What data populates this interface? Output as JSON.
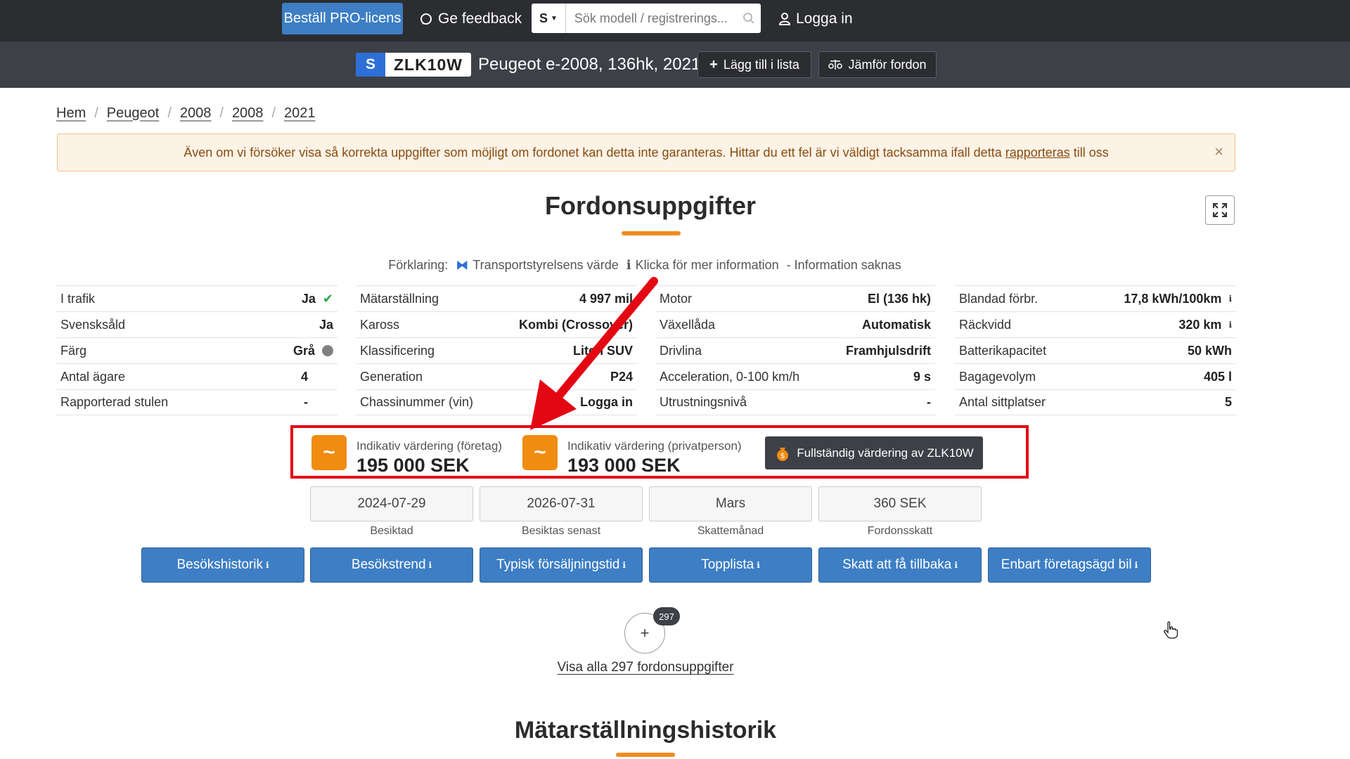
{
  "topbar": {
    "pro_label": "Beställ PRO-licens",
    "feedback_label": "Ge feedback",
    "search_select": "S",
    "search_placeholder": "Sök modell / registrerings...",
    "login_label": "Logga in"
  },
  "vehicle": {
    "plate_country": "S",
    "plate": "ZLK10W",
    "title": "Peugeot e-2008, 136hk, 2021",
    "add_list_label": "Lägg till i lista",
    "compare_label": "Jämför fordon"
  },
  "breadcrumb": [
    "Hem",
    "Peugeot",
    "2008",
    "2008",
    "2021"
  ],
  "alert": {
    "text_before": "Även om vi försöker visa så korrekta uppgifter som möjligt om fordonet kan detta inte garanteras. Hittar du ett fel är vi väldigt tacksamma ifall detta",
    "link": "rapporteras",
    "text_after": "till oss"
  },
  "section_title": "Fordonsuppgifter",
  "legend": {
    "prefix": "Förklaring:",
    "item1": "Transportstyrelsens värde",
    "item2": "Klicka för mer information",
    "item3": "- Information saknas"
  },
  "columns": [
    [
      {
        "label": "I trafik",
        "value": "Ja"
      },
      {
        "label": "Svensksåld",
        "value": "Ja"
      },
      {
        "label": "Färg",
        "value": "Grå"
      },
      {
        "label": "Antal ägare",
        "value": "4"
      },
      {
        "label": "Rapporterad stulen",
        "value": "-"
      }
    ],
    [
      {
        "label": "Mätarställning",
        "value": "4 997 mil"
      },
      {
        "label": "Kaross",
        "value": "Kombi (Crossover)"
      },
      {
        "label": "Klassificering",
        "value": "Liten SUV"
      },
      {
        "label": "Generation",
        "value": "P24"
      },
      {
        "label": "Chassinummer (vin)",
        "value": "Logga in"
      }
    ],
    [
      {
        "label": "Motor",
        "value": "El (136 hk)"
      },
      {
        "label": "Växellåda",
        "value": "Automatisk"
      },
      {
        "label": "Drivlina",
        "value": "Framhjulsdrift"
      },
      {
        "label": "Acceleration, 0-100 km/h",
        "value": "9 s"
      },
      {
        "label": "Utrustningsnivå",
        "value": "-"
      }
    ],
    [
      {
        "label": "Blandad förbr.",
        "value": "17,8 kWh/100km"
      },
      {
        "label": "Räckvidd",
        "value": "320 km"
      },
      {
        "label": "Batterikapacitet",
        "value": "50 kWh"
      },
      {
        "label": "Bagagevolym",
        "value": "405 l"
      },
      {
        "label": "Antal sittplatser",
        "value": "5"
      }
    ]
  ],
  "valuation": {
    "company_label": "Indikativ värdering (företag)",
    "company_amount": "195 000 SEK",
    "private_label": "Indikativ värdering (privatperson)",
    "private_amount": "193 000 SEK",
    "full_label": "Fullständig värdering av ZLK10W",
    "icon_symbol": "~"
  },
  "inspection": [
    {
      "value": "2024-07-29",
      "caption": "Besiktad"
    },
    {
      "value": "2026-07-31",
      "caption": "Besiktas senast"
    },
    {
      "value": "Mars",
      "caption": "Skattemånad"
    },
    {
      "value": "360 SEK",
      "caption": "Fordonsskatt"
    }
  ],
  "buttons": [
    "Besökshistorik",
    "Besökstrend",
    "Typisk försäljningstid",
    "Topplista",
    "Skatt att få tillbaka",
    "Enbart företagsägd bil"
  ],
  "more": {
    "badge": "297",
    "show_all": "Visa alla 297 fordonsuppgifter"
  },
  "section2_title": "Mätarställningshistorik",
  "colors": {
    "accent_orange": "#ef8c1f",
    "primary_blue": "#3d7ec4",
    "highlight_red": "#e30613"
  }
}
